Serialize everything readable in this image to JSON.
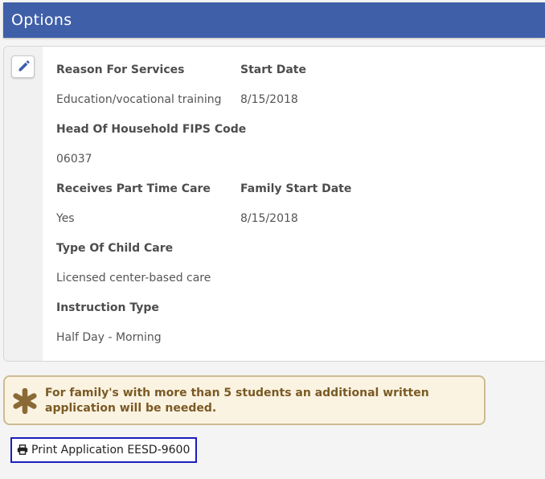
{
  "header": {
    "title": "Options"
  },
  "card": {
    "edit_icon": "pencil-icon",
    "fields": {
      "reason_for_services": {
        "label": "Reason For Services",
        "value": "Education/vocational training"
      },
      "start_date": {
        "label": "Start Date",
        "value": "8/15/2018"
      },
      "head_of_household_fips": {
        "label": "Head Of Household FIPS Code",
        "value": "06037"
      },
      "receives_part_time_care": {
        "label": "Receives Part Time Care",
        "value": "Yes"
      },
      "family_start_date": {
        "label": "Family Start Date",
        "value": "8/15/2018"
      },
      "type_of_child_care": {
        "label": "Type Of Child Care",
        "value": "Licensed center-based care"
      },
      "instruction_type": {
        "label": "Instruction Type",
        "value": "Half Day - Morning"
      }
    }
  },
  "notice": {
    "icon": "asterisk-icon",
    "text": "For family's with more than 5 students an additional written application will be needed."
  },
  "print_button": {
    "icon": "printer-icon",
    "label": "Print Application EESD-9600"
  },
  "colors": {
    "header_bg": "#3f5fa8",
    "notice_bg": "#fbf3e2",
    "notice_border": "#cdbb92",
    "notice_text": "#7a5a24",
    "focus_border": "#1d1dbf"
  }
}
